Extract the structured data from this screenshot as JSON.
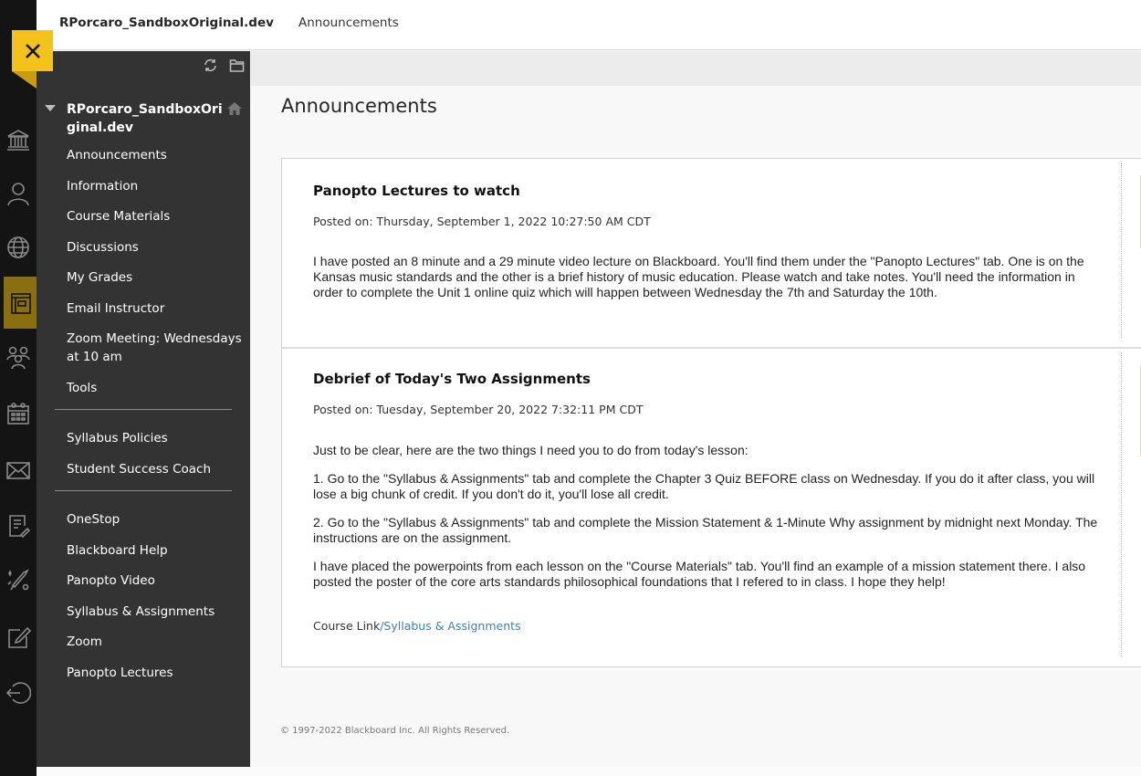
{
  "header": {
    "course_name": "RPorcaro_SandboxOriginal.dev",
    "breadcrumb": "Announcements"
  },
  "rail": {
    "close_icon": "close-icon",
    "icons": [
      "institution-icon",
      "profile-icon",
      "globe-icon",
      "courses-icon",
      "groups-icon",
      "calendar-icon",
      "messages-icon",
      "grades-icon",
      "tools-icon",
      "edit-icon",
      "sign-out-icon"
    ],
    "active": "courses-icon",
    "accent_color": "#f3c21b"
  },
  "menu": {
    "title": "RPorcaro_SandboxOriginal.dev",
    "tools": [
      "refresh-icon",
      "folder-icon"
    ],
    "groups": [
      [
        "Announcements",
        "Information",
        "Course Materials",
        "Discussions",
        "My Grades",
        "Email Instructor",
        "Zoom Meeting: Wednesdays at 10 am",
        "Tools"
      ],
      [
        "Syllabus Policies",
        "Student Success Coach"
      ],
      [
        "OneStop",
        "Blackboard Help",
        "Panopto Video",
        "Syllabus & Assignments",
        "Zoom",
        "Panopto Lectures"
      ]
    ]
  },
  "main": {
    "title": "Announcements",
    "announcements": [
      {
        "title": "Panopto Lectures to watch",
        "posted": "Posted on: Thursday, September 1, 2022 10:27:50 AM CDT",
        "paragraphs": [
          "I have posted an 8 minute and a 29 minute video lecture on Blackboard. You'll find them under the \"Panopto Lectures\" tab. One is on the Kansas music standards and the other is a brief history of music education. Please watch and take notes. You'll need the information in order to complete the Unit 1 online quiz which will happen between Wednesday the 7th and Saturday the 10th."
        ]
      },
      {
        "title": "Debrief of Today's Two Assignments",
        "posted": "Posted on: Tuesday, September 20, 2022 7:32:11 PM CDT",
        "paragraphs": [
          "Just to be clear, here are the two things I need you to do from today's lesson:",
          "1. Go to the \"Syllabus & Assignments\" tab and complete the Chapter 3 Quiz BEFORE class on Wednesday. If you do it after class, you will lose a big chunk of credit. If you don't do it, you'll lose all credit.",
          "2. Go to the \"Syllabus & Assignments\" tab and complete the Mission Statement & 1-Minute Why assignment by midnight next Monday. The instructions are on the assignment.",
          "I have placed the powerpoints from each lesson on the \"Course Materials\" tab. You'll find an example of a mission statement there. I also posted the poster of the core arts standards philosophical foundations that I refered to in class. I hope they help!"
        ],
        "link_prefix": "Course Link",
        "link_label": "/Syllabus & Assignments"
      }
    ]
  },
  "footer": "© 1997-2022 Blackboard Inc. All Rights Reserved."
}
